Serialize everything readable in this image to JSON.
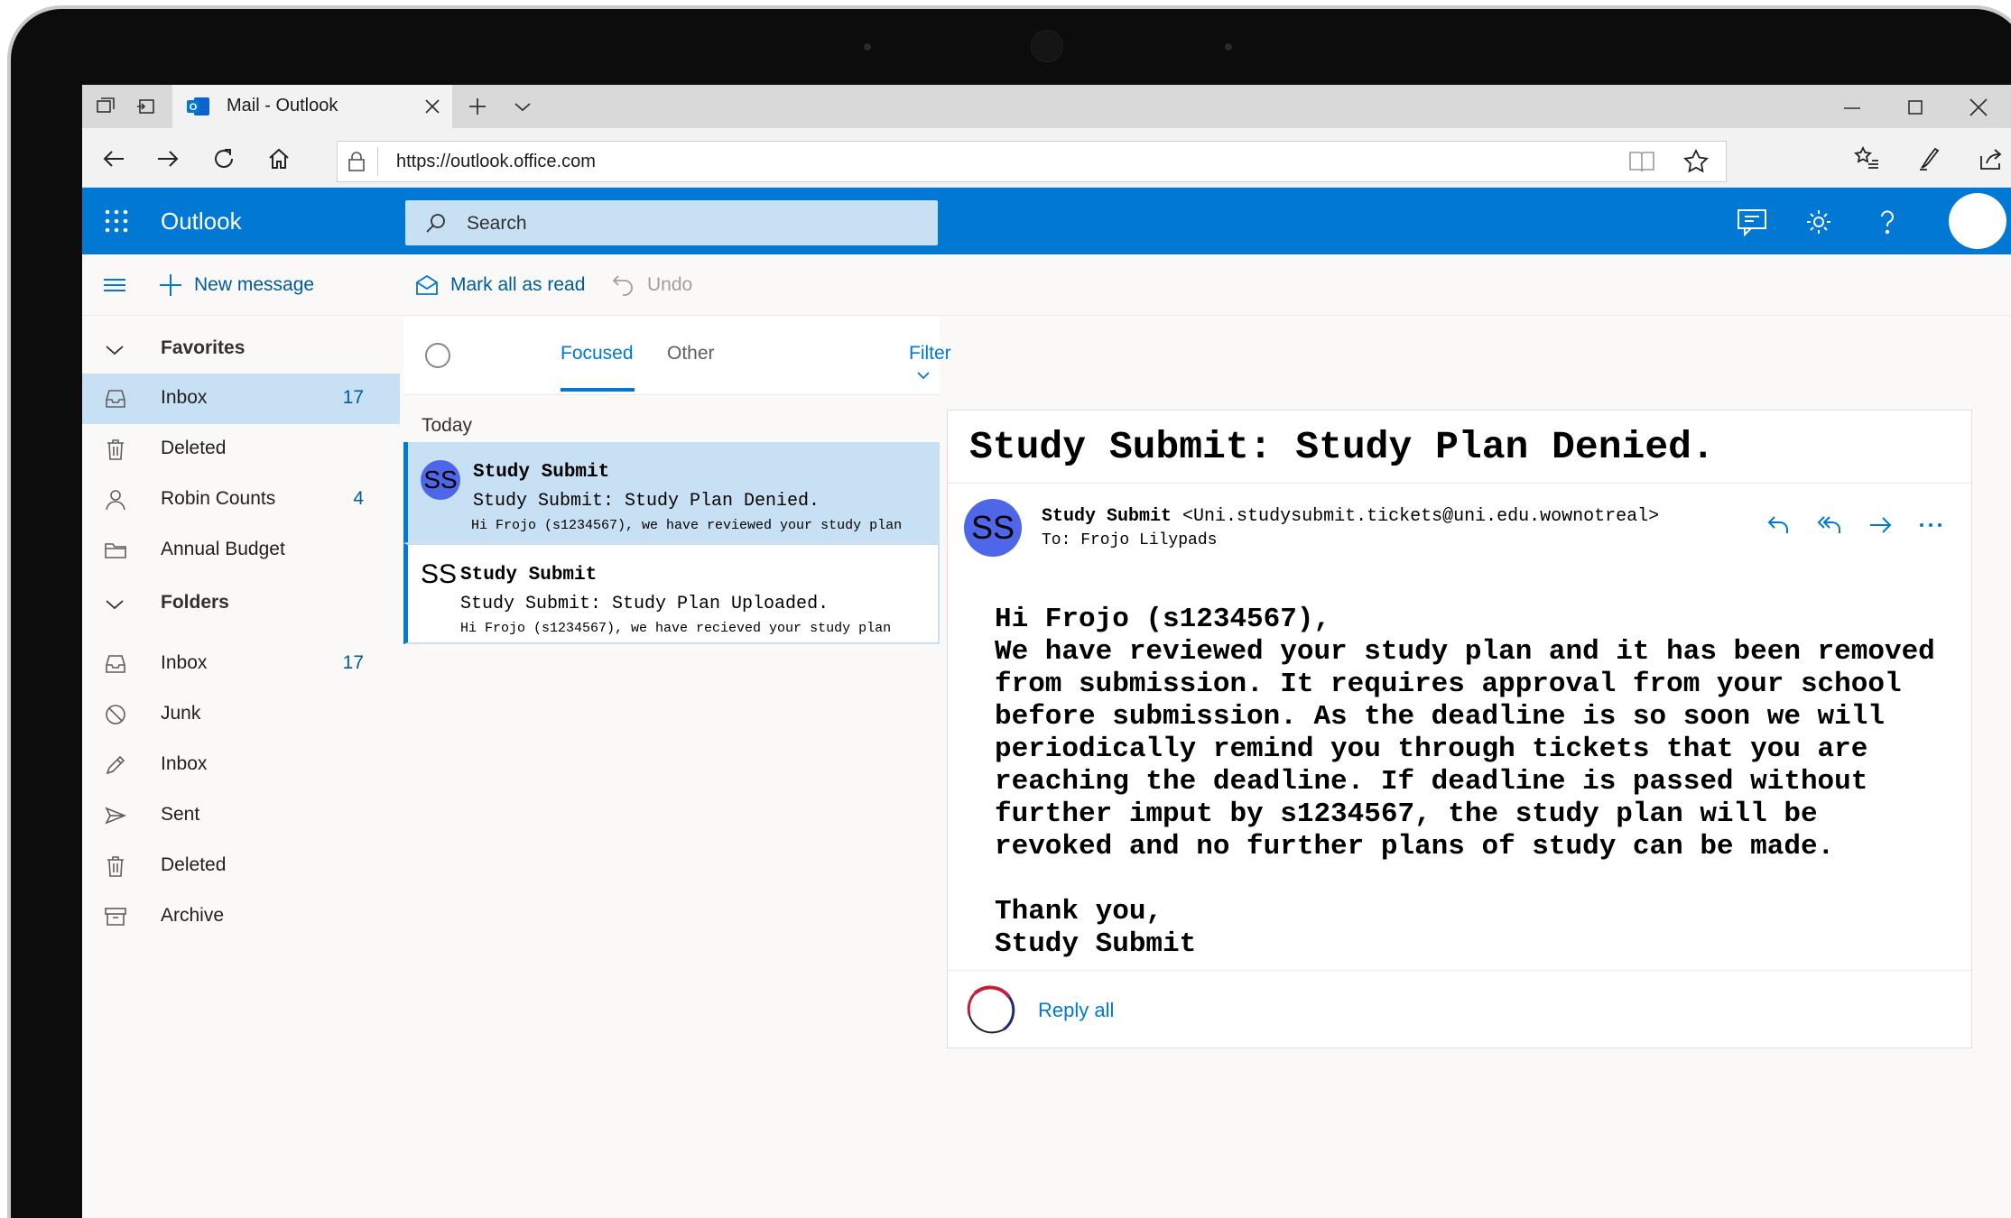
{
  "browser": {
    "tab_title": "Mail - Outlook",
    "url": "https://outlook.office.com"
  },
  "header": {
    "app_name": "Outlook",
    "search_placeholder": "Search"
  },
  "commands": {
    "new_message": "New message",
    "mark_all_read": "Mark all as read",
    "undo": "Undo"
  },
  "folders": {
    "favorites_label": "Favorites",
    "favorites": [
      {
        "label": "Inbox",
        "count": "17",
        "icon": "inbox-icon",
        "selected": true
      },
      {
        "label": "Deleted",
        "count": "",
        "icon": "trash-icon"
      },
      {
        "label": "Robin Counts",
        "count": "4",
        "icon": "person-icon"
      },
      {
        "label": "Annual Budget",
        "count": "",
        "icon": "folder-icon"
      }
    ],
    "folders_label": "Folders",
    "folders": [
      {
        "label": "Inbox",
        "count": "17",
        "icon": "inbox-icon"
      },
      {
        "label": "Junk",
        "count": "",
        "icon": "block-icon"
      },
      {
        "label": "Inbox",
        "count": "",
        "icon": "pencil-icon"
      },
      {
        "label": "Sent",
        "count": "",
        "icon": "send-icon"
      },
      {
        "label": "Deleted",
        "count": "",
        "icon": "trash-icon"
      },
      {
        "label": "Archive",
        "count": "",
        "icon": "archive-icon"
      }
    ]
  },
  "message_list": {
    "tabs": {
      "focused": "Focused",
      "other": "Other"
    },
    "filter": "Filter",
    "group_label": "Today",
    "messages": [
      {
        "initials": "SS",
        "sender": "Study Submit",
        "subject": "Study Submit: Study Plan Denied.",
        "preview": "Hi Frojo (s1234567), we have reviewed your study plan"
      },
      {
        "initials": "SS",
        "sender": "Study Submit",
        "subject": "Study Submit: Study Plan Uploaded.",
        "preview": "Hi Frojo (s1234567), we have recieved your study plan"
      }
    ]
  },
  "reading": {
    "subject": "Study Submit: Study Plan Denied.",
    "initials": "SS",
    "from_name": "Study Submit",
    "from_email": "<Uni.studysubmit.tickets@uni.edu.wownotreal>",
    "to": "To: Frojo Lilypads",
    "body": "Hi Frojo (s1234567),\nWe have reviewed your study plan and it has been removed\nfrom submission. It requires approval from your school\nbefore submission. As the deadline is so soon we will\nperiodically remind you through tickets that you are\nreaching the deadline. If deadline is passed without\nfurther imput by s1234567, the study plan will be\nrevoked and no further plans of study can be made.\n\nThank you,\nStudy Submit",
    "reply_all": "Reply all"
  },
  "colors": {
    "brand": "#0078d4",
    "selected_bg": "#c7e0f4",
    "avatar": "#4e66e8"
  }
}
